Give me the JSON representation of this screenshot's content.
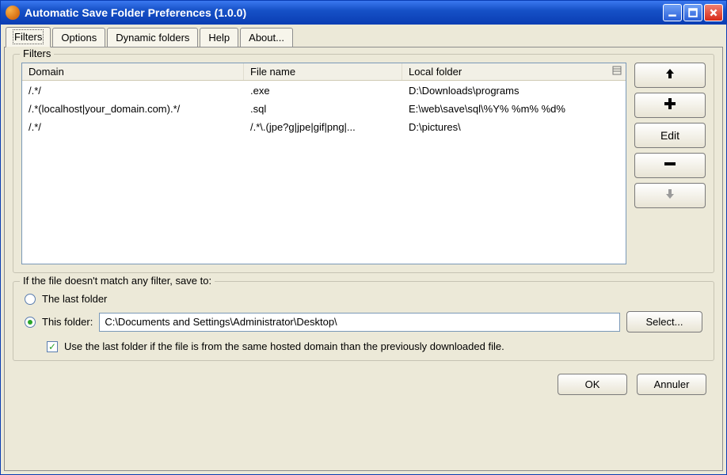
{
  "window": {
    "title": "Automatic Save Folder Preferences (1.0.0)"
  },
  "tabs": {
    "filters": "Filters",
    "options": "Options",
    "dynamic": "Dynamic folders",
    "help": "Help",
    "about": "About..."
  },
  "filters": {
    "legend": "Filters",
    "columns": {
      "domain": "Domain",
      "filename": "File name",
      "localfolder": "Local folder"
    },
    "rows": [
      {
        "domain": "/.*/",
        "filename": ".exe",
        "localfolder": "D:\\Downloads\\programs"
      },
      {
        "domain": "/.*(localhost|your_domain.com).*/",
        "filename": ".sql",
        "localfolder": "E:\\web\\save\\sql\\%Y% %m% %d%"
      },
      {
        "domain": "/.*/",
        "filename": "/.*\\.(jpe?g|jpe|gif|png|...",
        "localfolder": "D:\\pictures\\"
      }
    ],
    "buttons": {
      "up": "↑",
      "add": "+",
      "edit": "Edit",
      "remove": "−",
      "down": "↓"
    }
  },
  "fallback": {
    "legend": "If the file doesn't match any filter, save to:",
    "last_label": "The last folder",
    "this_label": "This folder:",
    "path": "C:\\Documents and Settings\\Administrator\\Desktop\\",
    "select_label": "Select...",
    "checkbox_label": "Use the last folder if the file is from the same hosted domain than the previously downloaded file."
  },
  "footer": {
    "ok": "OK",
    "cancel": "Annuler"
  }
}
